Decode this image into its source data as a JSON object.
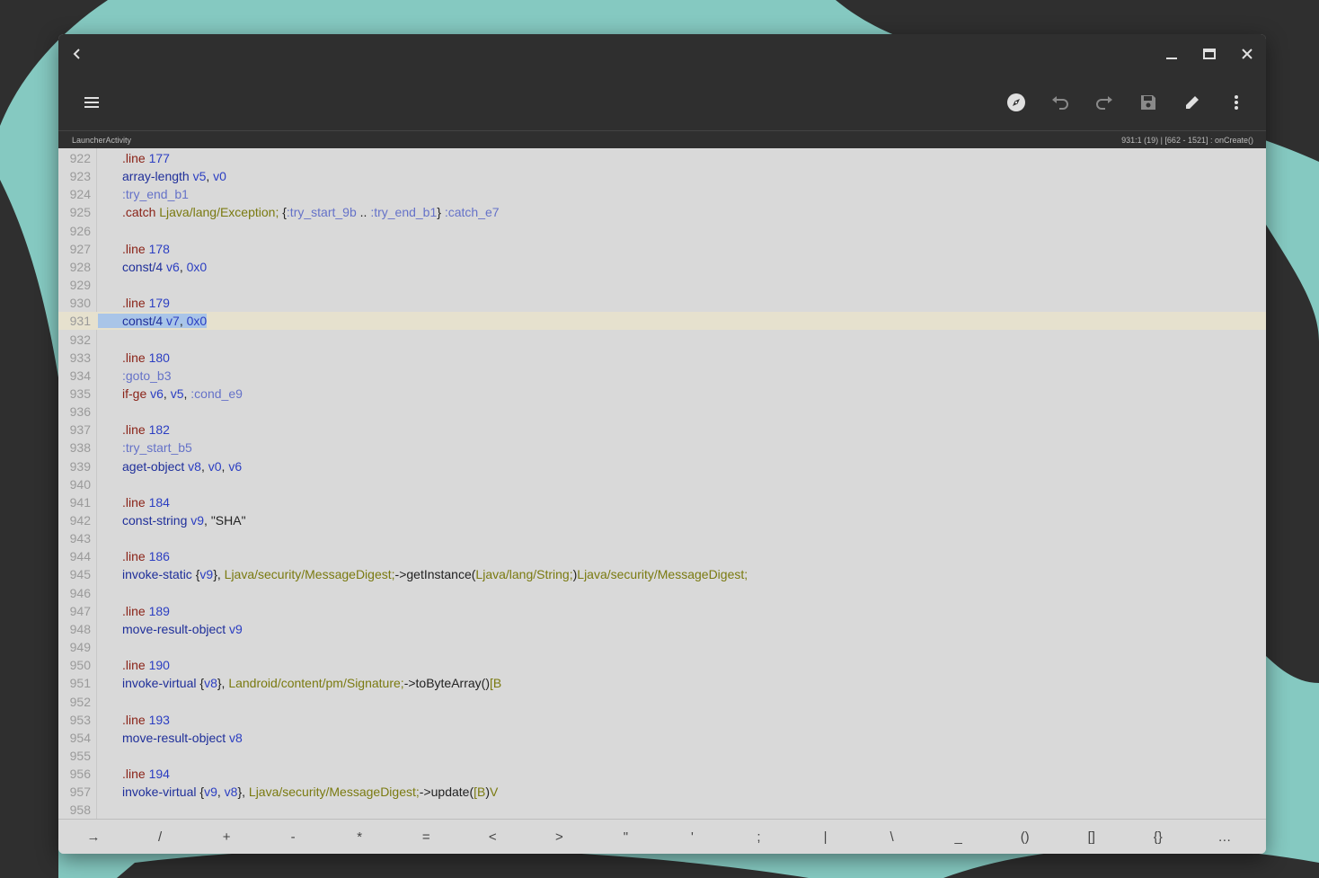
{
  "window": {
    "subtitle_left": "LauncherActivity",
    "subtitle_right": "931:1 (19)  |  [662 - 1521] : onCreate()"
  },
  "icons": {
    "back": "chevron-left-icon",
    "minimize": "minimize-icon",
    "maximize": "maximize-icon",
    "close": "close-icon",
    "menu": "hamburger-menu-icon",
    "navigate": "compass-icon",
    "undo": "undo-icon",
    "redo": "redo-icon",
    "save": "save-icon",
    "edit": "pencil-icon",
    "more": "more-vertical-icon"
  },
  "current_line": "931",
  "lines": [
    {
      "n": "922",
      "t": [
        [
          "c-dir",
          ".line"
        ],
        [
          "c-plain",
          " "
        ],
        [
          "c-num",
          "177"
        ]
      ]
    },
    {
      "n": "923",
      "t": [
        [
          "c-kw",
          "array-length"
        ],
        [
          "c-plain",
          " "
        ],
        [
          "c-num",
          "v5"
        ],
        [
          "c-plain",
          ", "
        ],
        [
          "c-num",
          "v0"
        ]
      ]
    },
    {
      "n": "924",
      "t": [
        [
          "c-label",
          ":try_end_b1"
        ]
      ]
    },
    {
      "n": "925",
      "t": [
        [
          "c-dir",
          ".catch"
        ],
        [
          "c-plain",
          " "
        ],
        [
          "c-type",
          "Ljava/lang/Exception;"
        ],
        [
          "c-plain",
          " {"
        ],
        [
          "c-label",
          ":try_start_9b"
        ],
        [
          "c-plain",
          " .. "
        ],
        [
          "c-label",
          ":try_end_b1"
        ],
        [
          "c-plain",
          "} "
        ],
        [
          "c-label",
          ":catch_e7"
        ]
      ]
    },
    {
      "n": "926",
      "t": []
    },
    {
      "n": "927",
      "t": [
        [
          "c-dir",
          ".line"
        ],
        [
          "c-plain",
          " "
        ],
        [
          "c-num",
          "178"
        ]
      ]
    },
    {
      "n": "928",
      "t": [
        [
          "c-kw",
          "const/4"
        ],
        [
          "c-plain",
          " "
        ],
        [
          "c-num",
          "v6"
        ],
        [
          "c-plain",
          ", "
        ],
        [
          "c-num",
          "0x0"
        ]
      ]
    },
    {
      "n": "929",
      "t": []
    },
    {
      "n": "930",
      "t": [
        [
          "c-dir",
          ".line"
        ],
        [
          "c-plain",
          " "
        ],
        [
          "c-num",
          "179"
        ]
      ]
    },
    {
      "n": "931",
      "t": [
        [
          "c-kw",
          "const/4"
        ],
        [
          "c-plain",
          " "
        ],
        [
          "c-num",
          "v7"
        ],
        [
          "c-plain",
          ", "
        ],
        [
          "c-num",
          "0x0"
        ]
      ]
    },
    {
      "n": "932",
      "t": []
    },
    {
      "n": "933",
      "t": [
        [
          "c-dir",
          ".line"
        ],
        [
          "c-plain",
          " "
        ],
        [
          "c-num",
          "180"
        ]
      ]
    },
    {
      "n": "934",
      "t": [
        [
          "c-label",
          ":goto_b3"
        ]
      ]
    },
    {
      "n": "935",
      "t": [
        [
          "c-dir",
          "if-ge"
        ],
        [
          "c-plain",
          " "
        ],
        [
          "c-num",
          "v6"
        ],
        [
          "c-plain",
          ", "
        ],
        [
          "c-num",
          "v5"
        ],
        [
          "c-plain",
          ", "
        ],
        [
          "c-label",
          ":cond_e9"
        ]
      ]
    },
    {
      "n": "936",
      "t": []
    },
    {
      "n": "937",
      "t": [
        [
          "c-dir",
          ".line"
        ],
        [
          "c-plain",
          " "
        ],
        [
          "c-num",
          "182"
        ]
      ]
    },
    {
      "n": "938",
      "t": [
        [
          "c-label",
          ":try_start_b5"
        ]
      ]
    },
    {
      "n": "939",
      "t": [
        [
          "c-kw",
          "aget-object"
        ],
        [
          "c-plain",
          " "
        ],
        [
          "c-num",
          "v8"
        ],
        [
          "c-plain",
          ", "
        ],
        [
          "c-num",
          "v0"
        ],
        [
          "c-plain",
          ", "
        ],
        [
          "c-num",
          "v6"
        ]
      ]
    },
    {
      "n": "940",
      "t": []
    },
    {
      "n": "941",
      "t": [
        [
          "c-dir",
          ".line"
        ],
        [
          "c-plain",
          " "
        ],
        [
          "c-num",
          "184"
        ]
      ]
    },
    {
      "n": "942",
      "t": [
        [
          "c-kw",
          "const-string"
        ],
        [
          "c-plain",
          " "
        ],
        [
          "c-num",
          "v9"
        ],
        [
          "c-plain",
          ", "
        ],
        [
          "c-str",
          "\"SHA\""
        ]
      ]
    },
    {
      "n": "943",
      "t": []
    },
    {
      "n": "944",
      "t": [
        [
          "c-dir",
          ".line"
        ],
        [
          "c-plain",
          " "
        ],
        [
          "c-num",
          "186"
        ]
      ]
    },
    {
      "n": "945",
      "t": [
        [
          "c-kw",
          "invoke-static"
        ],
        [
          "c-plain",
          " {"
        ],
        [
          "c-num",
          "v9"
        ],
        [
          "c-plain",
          "}, "
        ],
        [
          "c-type",
          "Ljava/security/MessageDigest;"
        ],
        [
          "c-plain",
          "->getInstance("
        ],
        [
          "c-type",
          "Ljava/lang/String;"
        ],
        [
          "c-plain",
          ")"
        ],
        [
          "c-type",
          "Ljava/security/MessageDigest;"
        ]
      ]
    },
    {
      "n": "946",
      "t": []
    },
    {
      "n": "947",
      "t": [
        [
          "c-dir",
          ".line"
        ],
        [
          "c-plain",
          " "
        ],
        [
          "c-num",
          "189"
        ]
      ]
    },
    {
      "n": "948",
      "t": [
        [
          "c-kw",
          "move-result-object"
        ],
        [
          "c-plain",
          " "
        ],
        [
          "c-num",
          "v9"
        ]
      ]
    },
    {
      "n": "949",
      "t": []
    },
    {
      "n": "950",
      "t": [
        [
          "c-dir",
          ".line"
        ],
        [
          "c-plain",
          " "
        ],
        [
          "c-num",
          "190"
        ]
      ]
    },
    {
      "n": "951",
      "t": [
        [
          "c-kw",
          "invoke-virtual"
        ],
        [
          "c-plain",
          " {"
        ],
        [
          "c-num",
          "v8"
        ],
        [
          "c-plain",
          "}, "
        ],
        [
          "c-type",
          "Landroid/content/pm/Signature;"
        ],
        [
          "c-plain",
          "->toByteArray()"
        ],
        [
          "c-type",
          "[B"
        ]
      ]
    },
    {
      "n": "952",
      "t": []
    },
    {
      "n": "953",
      "t": [
        [
          "c-dir",
          ".line"
        ],
        [
          "c-plain",
          " "
        ],
        [
          "c-num",
          "193"
        ]
      ]
    },
    {
      "n": "954",
      "t": [
        [
          "c-kw",
          "move-result-object"
        ],
        [
          "c-plain",
          " "
        ],
        [
          "c-num",
          "v8"
        ]
      ]
    },
    {
      "n": "955",
      "t": []
    },
    {
      "n": "956",
      "t": [
        [
          "c-dir",
          ".line"
        ],
        [
          "c-plain",
          " "
        ],
        [
          "c-num",
          "194"
        ]
      ]
    },
    {
      "n": "957",
      "t": [
        [
          "c-kw",
          "invoke-virtual"
        ],
        [
          "c-plain",
          " {"
        ],
        [
          "c-num",
          "v9"
        ],
        [
          "c-plain",
          ", "
        ],
        [
          "c-num",
          "v8"
        ],
        [
          "c-plain",
          "}, "
        ],
        [
          "c-type",
          "Ljava/security/MessageDigest;"
        ],
        [
          "c-plain",
          "->update("
        ],
        [
          "c-type",
          "[B"
        ],
        [
          "c-plain",
          ")"
        ],
        [
          "c-type",
          "V"
        ]
      ]
    },
    {
      "n": "958",
      "t": []
    }
  ],
  "symbols": [
    "→",
    "/",
    "+",
    "-",
    "*",
    "=",
    "<",
    ">",
    "\"",
    "'",
    ";",
    "|",
    "\\",
    "_",
    "()",
    "[]",
    "{}",
    "…"
  ]
}
